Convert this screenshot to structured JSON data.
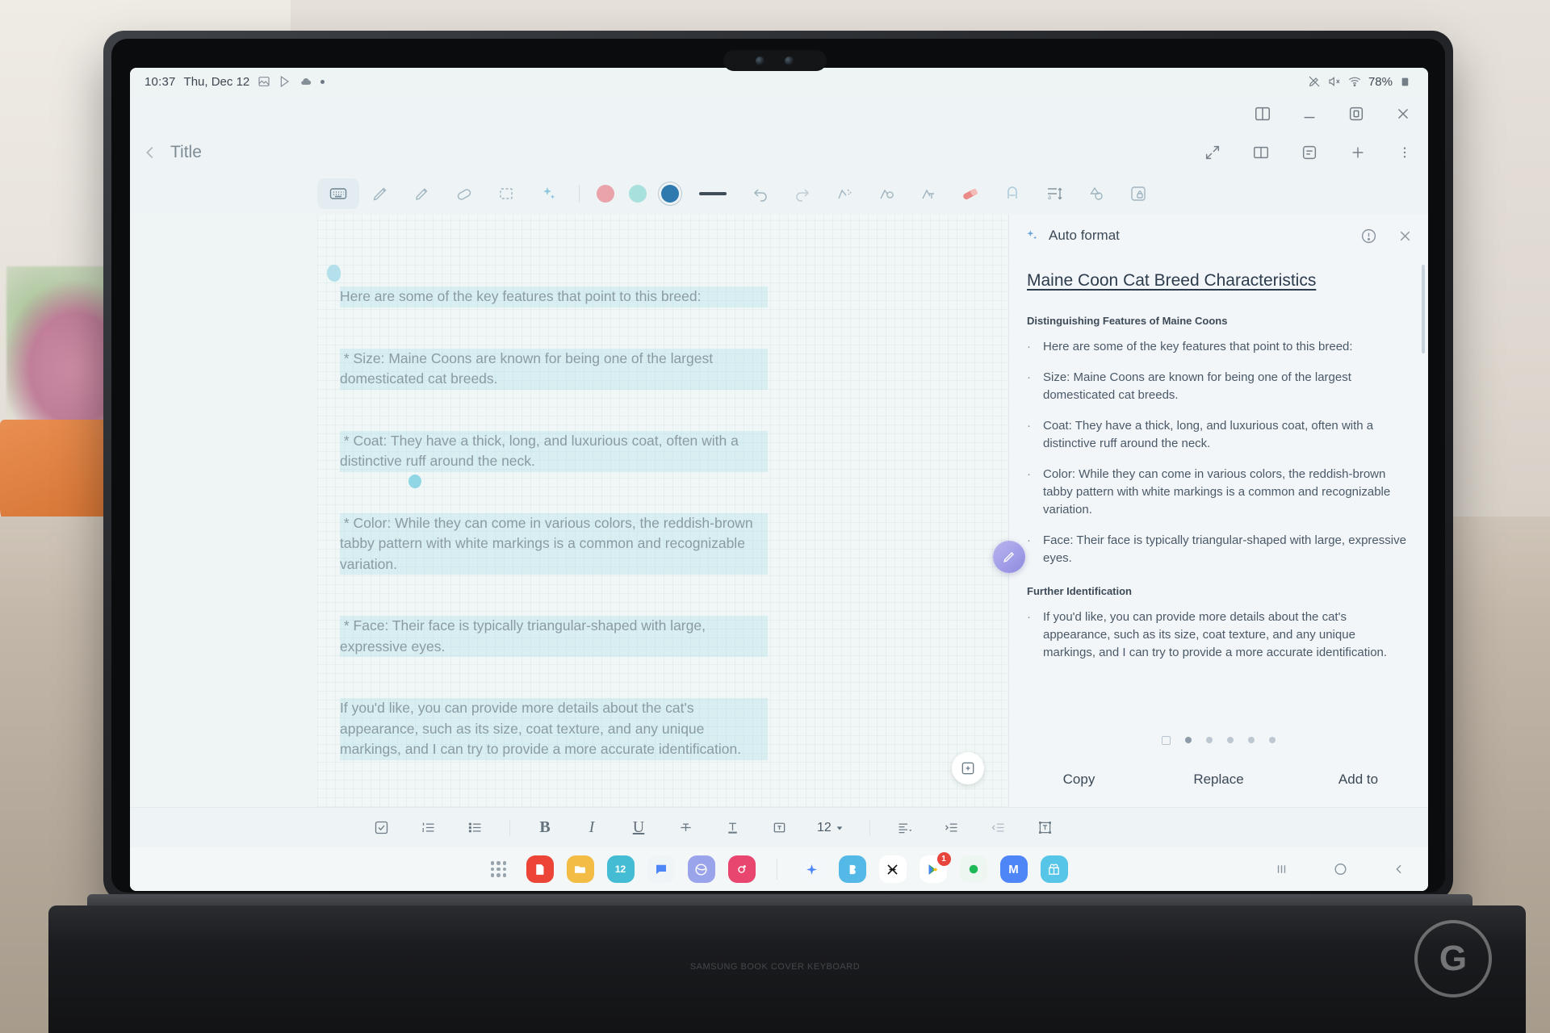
{
  "status_bar": {
    "time": "10:37",
    "date": "Thu, Dec 12",
    "icons": [
      "gallery-icon",
      "play-store-icon",
      "weather-cloud-icon",
      "dot-indicator"
    ],
    "right_icons": [
      "pen-detached-icon",
      "mute-icon",
      "wifi-icon"
    ],
    "battery": "78%"
  },
  "window": {
    "controls": [
      "split-view-icon",
      "minimize-icon",
      "maximize-icon",
      "close-icon"
    ]
  },
  "note_header": {
    "back_icon": "chevron-left-icon",
    "title": "Title",
    "actions": [
      "expand-icon",
      "book-view-icon",
      "outline-icon",
      "add-icon",
      "more-options-icon"
    ]
  },
  "pen_toolbar": {
    "tools": [
      {
        "name": "keyboard-icon",
        "selected": true
      },
      {
        "name": "pen-icon",
        "selected": false
      },
      {
        "name": "highlighter-icon",
        "selected": false
      },
      {
        "name": "eraser-icon",
        "selected": false
      },
      {
        "name": "selection-icon",
        "selected": false
      },
      {
        "name": "ai-sparkle-icon",
        "selected": false
      }
    ],
    "colors": [
      {
        "name": "color-swatch-pink",
        "hex": "#eaa3ab",
        "active": false
      },
      {
        "name": "color-swatch-teal",
        "hex": "#a7e0dc",
        "active": false
      },
      {
        "name": "color-swatch-blue",
        "hex": "#2e79ad",
        "active": true
      }
    ],
    "thickness_label": "stroke-thickness",
    "right_tools": [
      "undo-icon",
      "redo-icon",
      "shape-correct-icon",
      "auto-shape-icon",
      "convert-to-text-icon",
      "eraser-red-icon",
      "text-style-icon",
      "line-spacing-icon",
      "shapes-icon",
      "lock-icon"
    ]
  },
  "note_body": {
    "paragraphs": [
      "Here are some of the key features that point to this breed:",
      " * Size: Maine Coons are known for being one of the largest domesticated cat breeds.",
      " * Coat: They have a thick, long, and luxurious coat, often with a distinctive ruff around the neck.",
      " * Color: While they can come in various colors, the reddish-brown tabby pattern with white markings is a common and recognizable variation.",
      " * Face: Their face is typically triangular-shaped with large, expressive eyes.",
      "If you'd like, you can provide more details about the cat's appearance, such as its size, coat texture, and any unique markings, and I can try to provide a more accurate identification."
    ],
    "add_page_icon": "add-page-icon"
  },
  "ai_panel": {
    "icon": "ai-sparkle-icon",
    "header_title": "Auto format",
    "info_icon": "info-icon",
    "close_icon": "close-icon",
    "doc_title": "Maine Coon Cat Breed Characteristics",
    "sections": [
      {
        "heading": "Distinguishing Features of Maine Coons",
        "items": [
          "Here are some of the key features that point to this breed:",
          "Size: Maine Coons are known for being one of the largest domesticated cat breeds.",
          "Coat: They have a thick, long, and luxurious coat, often with a distinctive ruff around the neck.",
          "Color: While they can come in various colors, the reddish-brown tabby pattern with white markings is a common and recognizable variation.",
          "Face: Their face is typically triangular-shaped with large, expressive eyes."
        ]
      },
      {
        "heading": "Further Identification",
        "items": [
          "If you'd like, you can provide more details about the cat's appearance, such as its size, coat texture, and any unique markings, and I can try to provide a more accurate identification."
        ]
      }
    ],
    "page_dots": {
      "total": 5,
      "active_index": 0,
      "list_icon": "list-view-icon"
    },
    "actions": [
      {
        "name": "copy-button",
        "label": "Copy"
      },
      {
        "name": "replace-button",
        "label": "Replace"
      },
      {
        "name": "add-to-button",
        "label": "Add to"
      }
    ],
    "fab": "pen-fab-icon"
  },
  "format_bar": {
    "left_tools": [
      "checklist-icon",
      "numbered-list-icon",
      "bullet-list-icon"
    ],
    "bold": "B",
    "italic": "I",
    "underline": "U",
    "strikethrough_icon": "strikethrough-icon",
    "text-color_icon": "text-color-icon",
    "textbox_icon": "text-box-icon",
    "font_size": "12",
    "font_size_caret": "caret-down-icon",
    "right_tools": [
      "align-icon",
      "indent-increase-icon",
      "indent-decrease-icon",
      "text-frame-icon"
    ]
  },
  "dock": {
    "apps_grid_icon": "apps-grid-icon",
    "apps": [
      {
        "name": "dock-app-samsung-notes",
        "glyph": "",
        "bg": "#ec4436"
      },
      {
        "name": "dock-app-files",
        "glyph": "",
        "bg": "#f2bc45"
      },
      {
        "name": "dock-app-calendar",
        "glyph": "12",
        "bg": "#44bdd4"
      },
      {
        "name": "dock-app-messages",
        "glyph": "",
        "bg": "#eff4f7"
      },
      {
        "name": "dock-app-internet",
        "glyph": "",
        "bg": "#9aa4ea"
      },
      {
        "name": "dock-app-instagram",
        "glyph": "",
        "bg": "#e8456f"
      },
      {
        "name": "dock-app-galaxy-ai",
        "glyph": "",
        "bg": "#f3f7fa"
      },
      {
        "name": "dock-app-bixby",
        "glyph": "",
        "bg": "#55b9e8"
      },
      {
        "name": "dock-app-capcut",
        "glyph": "",
        "bg": "#ffffff"
      },
      {
        "name": "dock-app-play-store",
        "glyph": "",
        "bg": "#ffffff",
        "badge": "1"
      },
      {
        "name": "dock-app-spotify",
        "glyph": "",
        "bg": "#eef6f1"
      },
      {
        "name": "dock-app-messenger",
        "glyph": "M",
        "bg": "#4f86f7"
      },
      {
        "name": "dock-app-gift",
        "glyph": "",
        "bg": "#56c5e8"
      }
    ],
    "nav": [
      "recents-icon",
      "home-icon",
      "back-icon"
    ]
  },
  "device": {
    "keyboard_label": "SAMSUNG BOOK COVER KEYBOARD",
    "watermark": "G"
  }
}
